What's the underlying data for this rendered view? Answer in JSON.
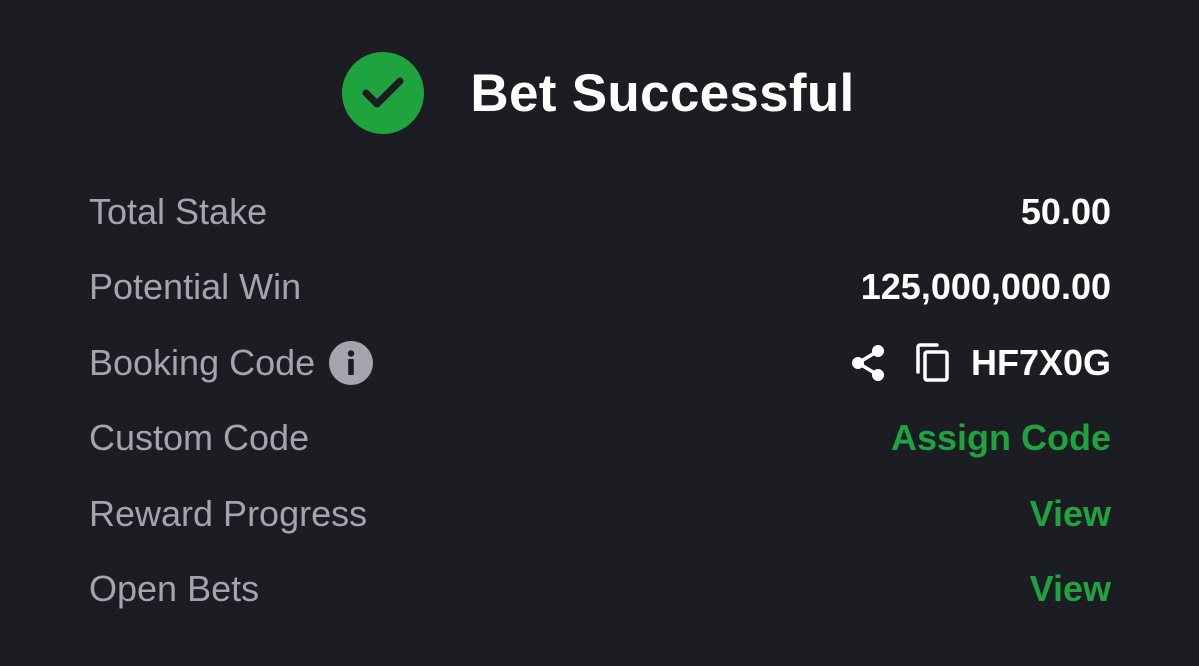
{
  "header": {
    "title": "Bet Successful",
    "icon": "check-circle-icon",
    "accent_color": "#1ea33f"
  },
  "rows": [
    {
      "label": "Total Stake",
      "value": "50.00"
    },
    {
      "label": "Potential Win",
      "value": "125,000,000.00"
    },
    {
      "label": "Booking Code",
      "value": "HF7X0G",
      "icons": [
        "info-icon",
        "share-icon",
        "copy-icon"
      ]
    },
    {
      "label": "Custom Code",
      "value": "Assign Code"
    },
    {
      "label": "Reward Progress",
      "value": "View"
    },
    {
      "label": "Open Bets",
      "value": "View"
    }
  ],
  "colors": {
    "background": "#1c1d23",
    "label": "#a3a4ad",
    "value": "#ffffff",
    "action": "#1ea33f"
  }
}
